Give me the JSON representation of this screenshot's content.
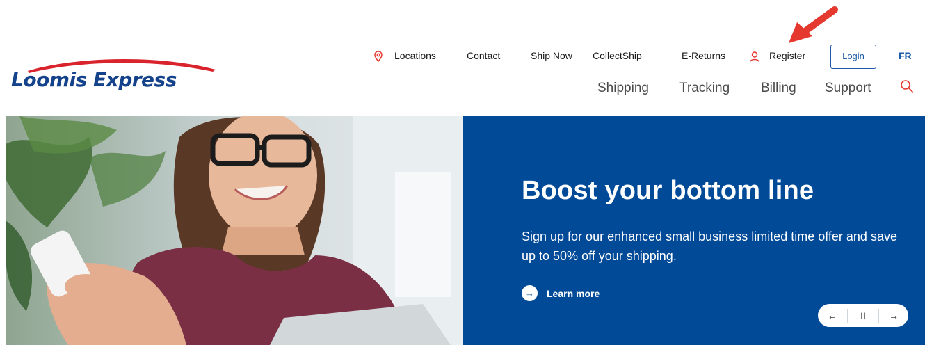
{
  "brand": {
    "name": "Loomis Express",
    "accent": "#004a98",
    "swoosh_color": "#d9232d"
  },
  "utility_nav": {
    "locations": "Locations",
    "contact": "Contact",
    "ship_now": "Ship Now",
    "collectship": "CollectShip",
    "e_returns": "E-Returns",
    "register": "Register",
    "login": "Login",
    "language": "FR"
  },
  "main_nav": {
    "shipping": "Shipping",
    "tracking": "Tracking",
    "billing": "Billing",
    "support": "Support"
  },
  "hero": {
    "title": "Boost your bottom line",
    "text": "Sign up for our enhanced small business limited time offer and save up to 50% off your shipping.",
    "cta": "Learn more",
    "controls": {
      "prev": "←",
      "pause": "II",
      "next": "→"
    }
  },
  "icons": [
    "map-pin-icon",
    "user-icon",
    "search-icon",
    "arrow-right-icon",
    "annotation-arrow-icon"
  ]
}
